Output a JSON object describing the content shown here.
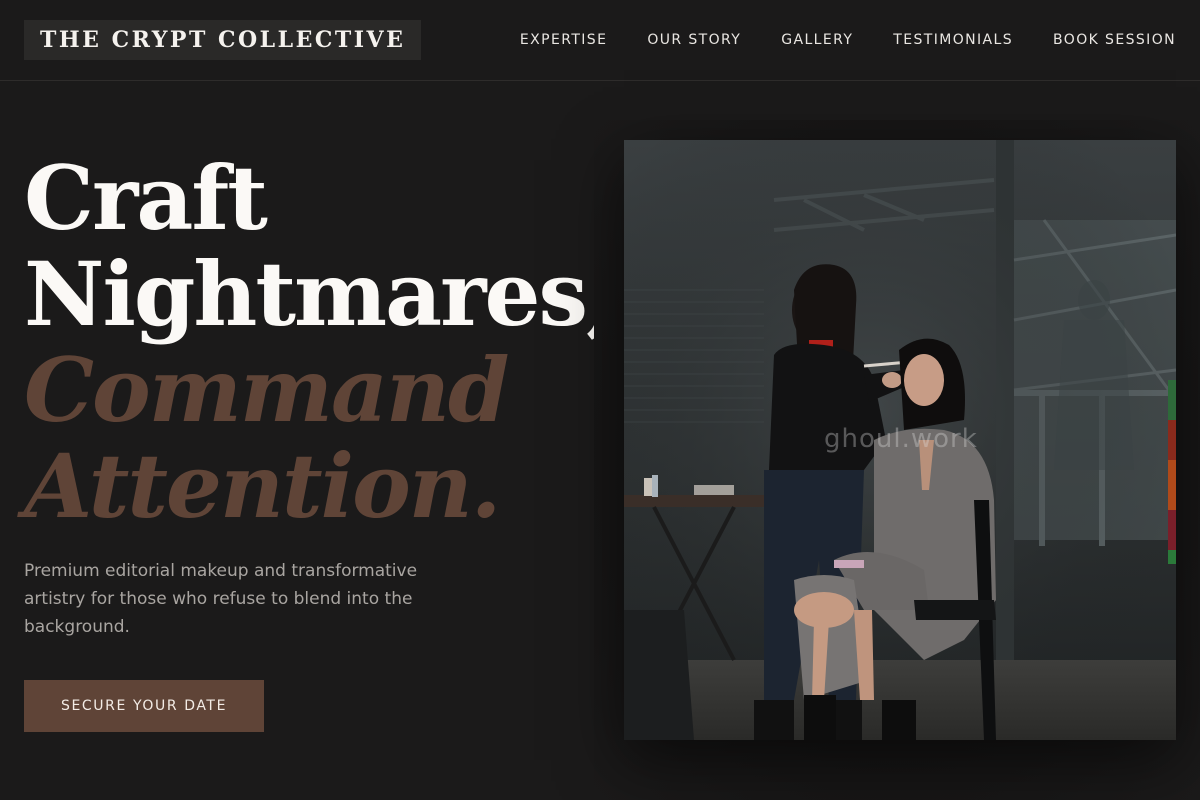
{
  "brand": {
    "name": "THE CRYPT COLLECTIVE"
  },
  "nav": {
    "items": [
      {
        "label": "EXPERTISE"
      },
      {
        "label": "OUR STORY"
      },
      {
        "label": "GALLERY"
      },
      {
        "label": "TESTIMONIALS"
      },
      {
        "label": "BOOK SESSION"
      }
    ]
  },
  "hero": {
    "title_line1": "Craft",
    "title_line2": "Nightmares,",
    "title_line3": "Command",
    "title_line4": "Attention.",
    "subtitle": "Premium editorial makeup and transformative artistry for those who refuse to blend into the background.",
    "cta_label": "SECURE YOUR DATE"
  },
  "image": {
    "watermark": "ghoul.work"
  },
  "colors": {
    "background": "#1b1a1a",
    "accent": "#5f4437",
    "text": "#fbf9f6",
    "muted": "#a9a5a1"
  }
}
